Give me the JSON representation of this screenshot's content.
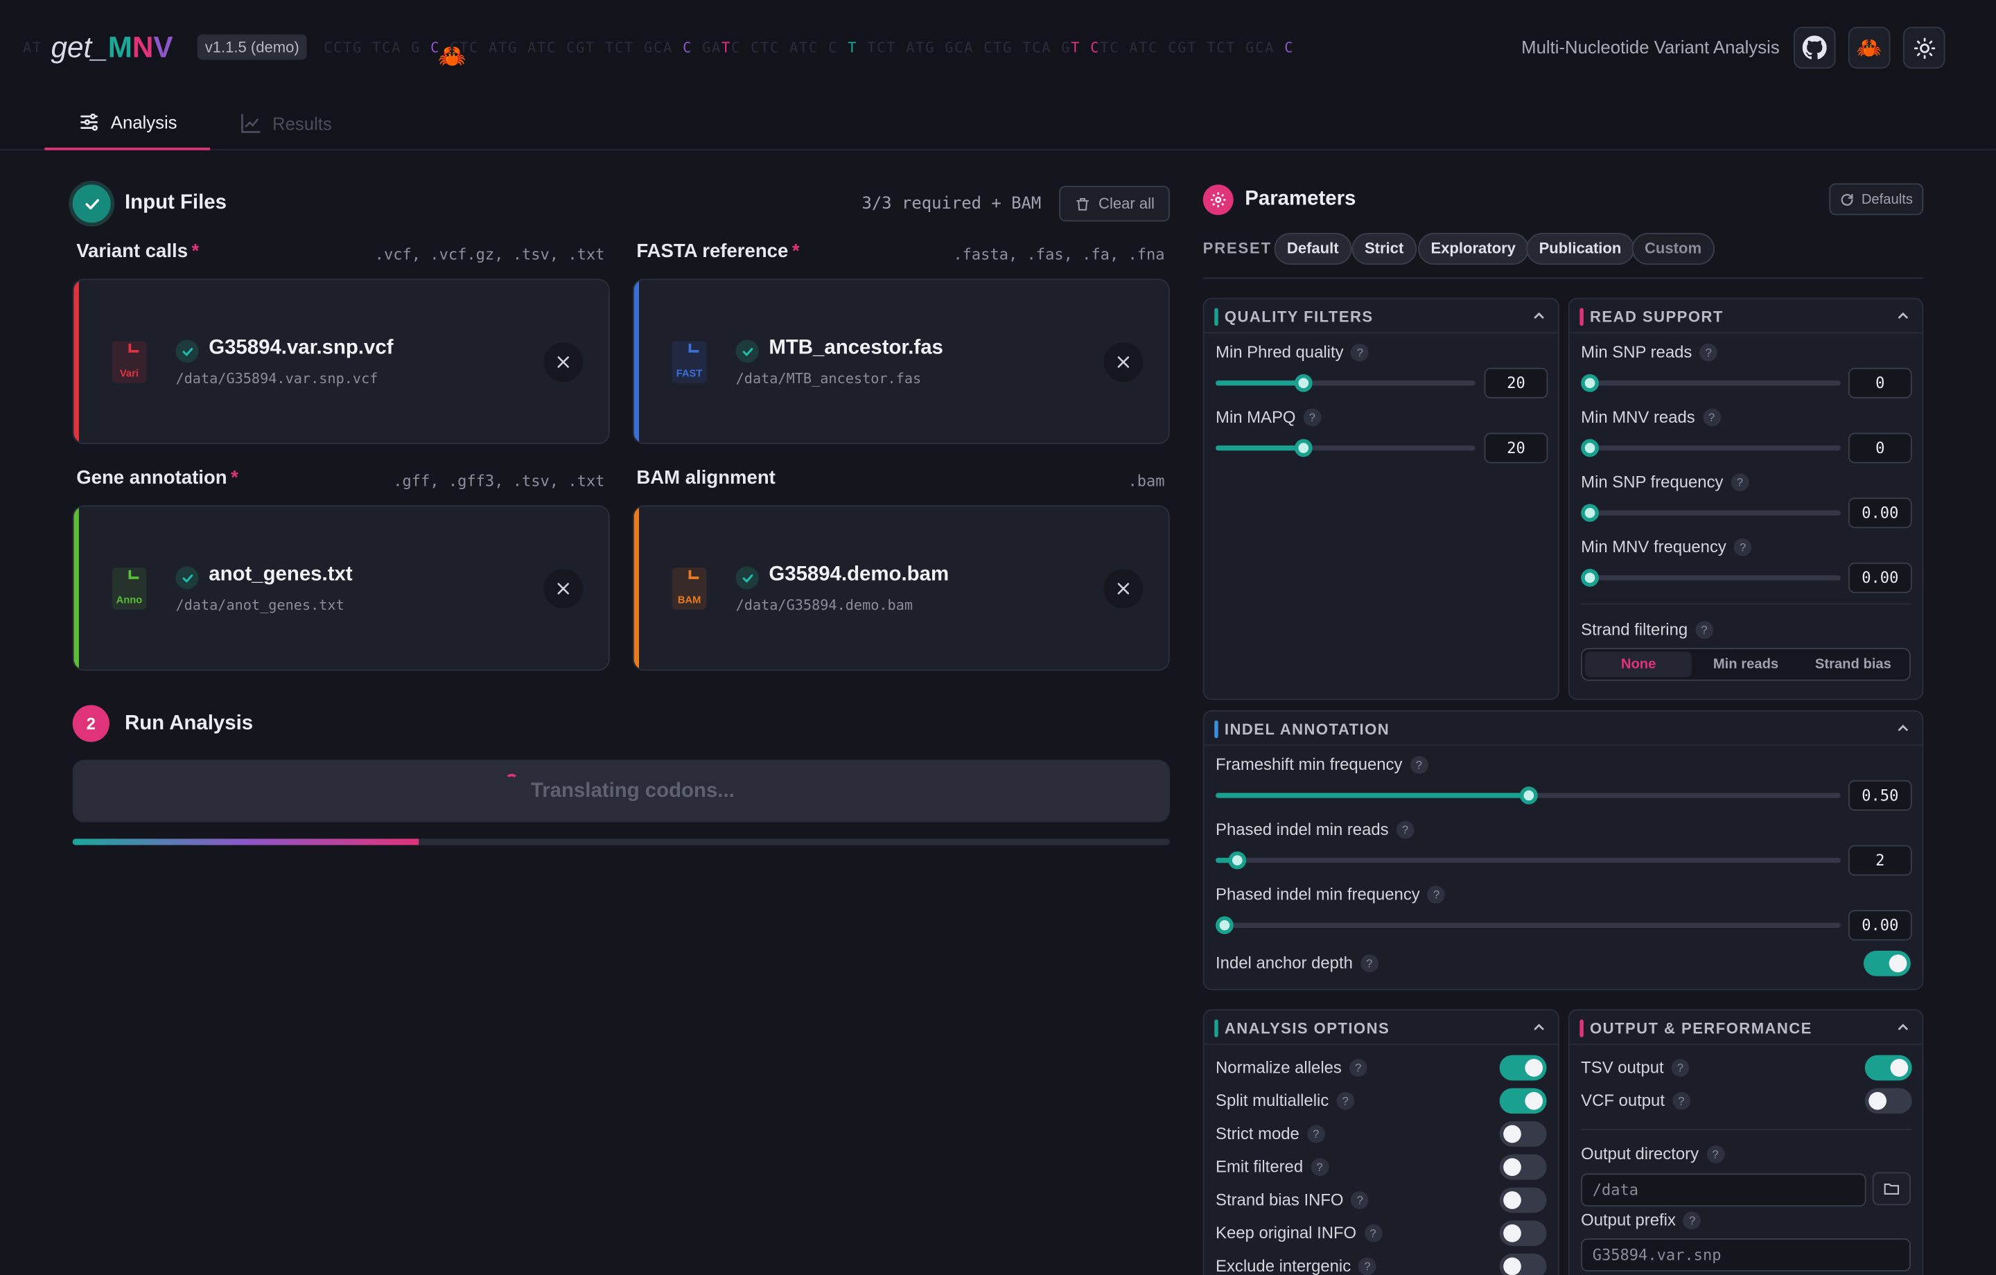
{
  "header": {
    "logo_pre": "get_",
    "logo_m": "M",
    "logo_n": "N",
    "logo_v": "V",
    "version": "v1.1.5 (demo)",
    "subtitle": "Multi-Nucleotide Variant Analysis",
    "dna_left": "AT",
    "dna_mid": "CCTG TCA G",
    "dna_right": "CTC ATG ATC CGT TCT GCA",
    "icons": [
      "github-icon",
      "crab-icon",
      "sun-icon"
    ]
  },
  "tabs": {
    "analysis": "Analysis",
    "results": "Results"
  },
  "input_files": {
    "title": "Input Files",
    "required_status": "3/3 required + BAM",
    "clear_all": "Clear all",
    "cards": [
      {
        "label": "Variant calls",
        "required": "*",
        "extensions": ".vcf, .vcf.gz, .tsv, .txt",
        "icon_text": "Vari",
        "file_name": "G35894.var.snp.vcf",
        "path": "/data/G35894.var.snp.vcf",
        "color": "#e0333f"
      },
      {
        "label": "FASTA reference",
        "required": "*",
        "extensions": ".fasta, .fas, .fa, .fna",
        "icon_text": "FAST",
        "file_name": "MTB_ancestor.fas",
        "path": "/data/MTB_ancestor.fas",
        "color": "#3b6fd6"
      },
      {
        "label": "Gene annotation",
        "required": "*",
        "extensions": ".gff, .gff3, .tsv, .txt",
        "icon_text": "Anno",
        "file_name": "anot_genes.txt",
        "path": "/data/anot_genes.txt",
        "color": "#5bbd38"
      },
      {
        "label": "BAM alignment",
        "required": "",
        "extensions": ".bam",
        "icon_text": "BAM",
        "file_name": "G35894.demo.bam",
        "path": "/data/G35894.demo.bam",
        "color": "#ea7a1e"
      }
    ]
  },
  "run": {
    "step": "2",
    "title": "Run Analysis",
    "button_label": "Translating codons...",
    "progress": 0.316
  },
  "parameters": {
    "title": "Parameters",
    "defaults": "Defaults",
    "preset_label": "PRESET",
    "presets": [
      "Default",
      "Strict",
      "Exploratory",
      "Publication",
      "Custom"
    ],
    "quality": {
      "title": "QUALITY FILTERS",
      "min_phred_label": "Min Phred quality",
      "min_phred_value": "20",
      "min_phred_frac": 0.34,
      "min_mapq_label": "Min MAPQ",
      "min_mapq_value": "20",
      "min_mapq_frac": 0.34
    },
    "read_support": {
      "title": "READ SUPPORT",
      "min_snp_reads_label": "Min SNP reads",
      "min_snp_reads_value": "0",
      "min_mnv_reads_label": "Min MNV reads",
      "min_mnv_reads_value": "0",
      "min_snp_freq_label": "Min SNP frequency",
      "min_snp_freq_value": "0.00",
      "min_mnv_freq_label": "Min MNV frequency",
      "min_mnv_freq_value": "0.00",
      "strand_label": "Strand filtering",
      "strand_options": [
        "None",
        "Min reads",
        "Strand bias"
      ],
      "strand_selected": "None"
    },
    "indel": {
      "title": "INDEL ANNOTATION",
      "frameshift_label": "Frameshift min frequency",
      "frameshift_value": "0.50",
      "frameshift_frac": 0.5,
      "phased_reads_label": "Phased indel min reads",
      "phased_reads_value": "2",
      "phased_reads_frac": 0.035,
      "phased_freq_label": "Phased indel min frequency",
      "phased_freq_value": "0.00",
      "phased_freq_frac": 0.015,
      "anchor_label": "Indel anchor depth",
      "anchor_on": true
    },
    "analysis_options": {
      "title": "ANALYSIS OPTIONS",
      "items": [
        {
          "label": "Normalize alleles",
          "on": true
        },
        {
          "label": "Split multiallelic",
          "on": true
        },
        {
          "label": "Strict mode",
          "on": false
        },
        {
          "label": "Emit filtered",
          "on": false
        },
        {
          "label": "Strand bias INFO",
          "on": false
        },
        {
          "label": "Keep original INFO",
          "on": false
        },
        {
          "label": "Exclude intergenic",
          "on": false
        }
      ]
    },
    "output": {
      "title": "OUTPUT & PERFORMANCE",
      "tsv_label": "TSV output",
      "tsv_on": true,
      "vcf_label": "VCF output",
      "vcf_on": false,
      "dir_label": "Output directory",
      "dir_placeholder": "/data",
      "prefix_label": "Output prefix",
      "prefix_placeholder": "G35894.var.snp"
    }
  },
  "colors": {
    "accent_pink": "#e0337a",
    "accent_teal": "#19a08f",
    "accent_purple": "#8d57c9",
    "quality_accent": "#19a08f",
    "read_accent": "#e0337a",
    "indel_accent": "#3b8fd6"
  }
}
